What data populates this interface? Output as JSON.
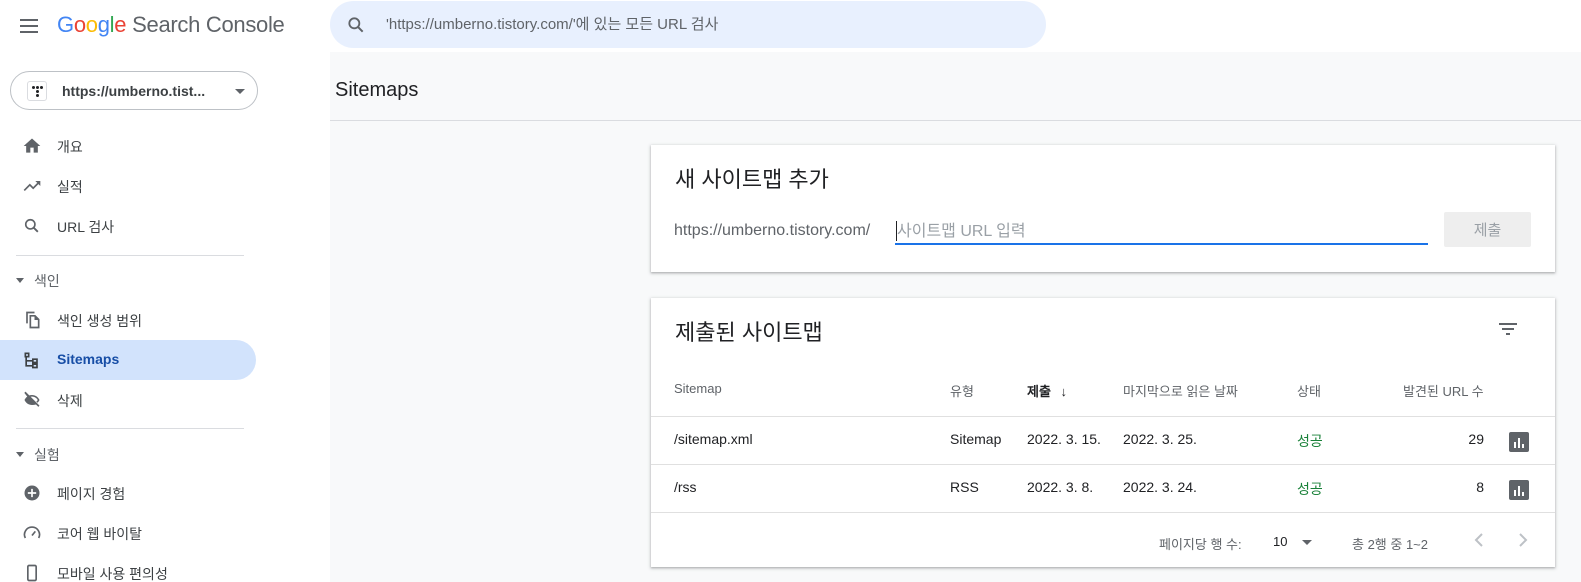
{
  "header": {
    "logo_letters": [
      "G",
      "o",
      "o",
      "g",
      "l",
      "e"
    ],
    "product": "Search Console",
    "search_placeholder": "'https://umberno.tistory.com/'에 있는 모든 URL 검사"
  },
  "property": {
    "label": "https://umberno.tist..."
  },
  "sidebar": {
    "items": [
      {
        "label": "개요",
        "icon": "home-icon"
      },
      {
        "label": "실적",
        "icon": "trending-up-icon"
      },
      {
        "label": "URL 검사",
        "icon": "search-icon"
      }
    ],
    "index_section": {
      "label": "색인",
      "items": [
        {
          "label": "색인 생성 범위",
          "icon": "file-copy-icon"
        },
        {
          "label": "Sitemaps",
          "icon": "sitemap-icon",
          "active": true
        },
        {
          "label": "삭제",
          "icon": "visibility-off-icon"
        }
      ]
    },
    "experience_section": {
      "label": "실험",
      "items": [
        {
          "label": "페이지 경험",
          "icon": "add-circle-icon"
        },
        {
          "label": "코어 웹 바이탈",
          "icon": "speed-gauge-icon"
        },
        {
          "label": "모바일 사용 편의성",
          "icon": "smartphone-icon"
        }
      ]
    }
  },
  "main": {
    "title": "Sitemaps",
    "add_card": {
      "title": "새 사이트맵 추가",
      "prefix": "https://umberno.tistory.com/",
      "input_placeholder": "사이트맵 URL 입력",
      "submit_label": "제출"
    },
    "submitted_card": {
      "title": "제출된 사이트맵",
      "columns": [
        "Sitemap",
        "유형",
        "제출",
        "마지막으로 읽은 날짜",
        "상태",
        "발견된 URL 수"
      ],
      "sort_arrow": "↓",
      "rows": [
        {
          "sitemap": "/sitemap.xml",
          "type": "Sitemap",
          "submitted": "2022. 3. 15.",
          "last_read": "2022. 3. 25.",
          "status": "성공",
          "urls": "29"
        },
        {
          "sitemap": "/rss",
          "type": "RSS",
          "submitted": "2022. 3. 8.",
          "last_read": "2022. 3. 24.",
          "status": "성공",
          "urls": "8"
        }
      ],
      "pager": {
        "rows_per_page_label": "페이지당 행 수:",
        "rows_per_page": "10",
        "range_label": "총 2행 중 1~2"
      }
    }
  },
  "colors": {
    "accent": "#1a73e8",
    "active_bg": "#d2e3fc",
    "success": "#188038",
    "search_bg": "#e8f0fe"
  }
}
